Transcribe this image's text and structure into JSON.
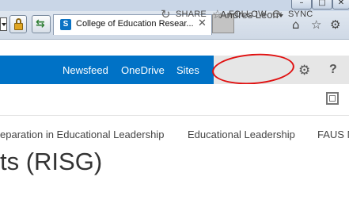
{
  "browser": {
    "window_controls": {
      "minimize": "–",
      "maximize": "□",
      "close": "✕"
    },
    "tab": {
      "favicon_letter": "S",
      "title": "College of Education Resear...",
      "close": "✕"
    },
    "icons": [
      "home-icon",
      "star-icon",
      "gear-icon"
    ]
  },
  "suitebar": {
    "links": [
      {
        "label": "Newsfeed"
      },
      {
        "label": "OneDrive"
      },
      {
        "label": "Sites"
      }
    ],
    "user": "Andres Leon",
    "help": "?",
    "colors": {
      "bar": "#0072c6",
      "user_area": "#e6e6e6",
      "annotation_circle": "#e01010"
    }
  },
  "actions": {
    "share": "SHARE",
    "follow": "FOLLOW",
    "sync": "SYNC"
  },
  "topnav": {
    "items": [
      {
        "label": "eparation in Educational Leadership"
      },
      {
        "label": "Educational Leadership"
      },
      {
        "label": "FAUS N"
      }
    ]
  },
  "page": {
    "title": "ts (RISG)"
  }
}
